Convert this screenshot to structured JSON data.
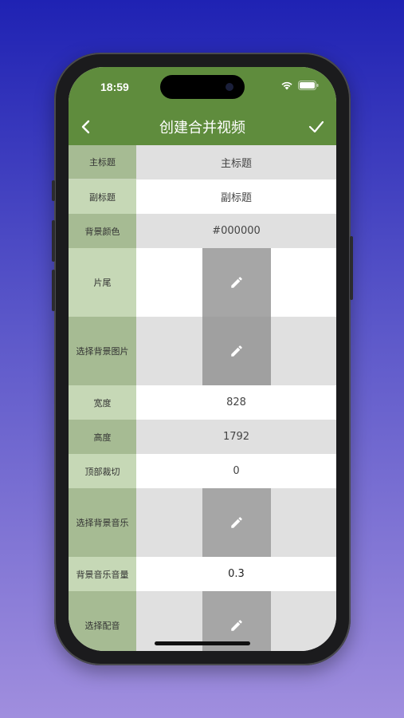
{
  "status": {
    "time": "18:59"
  },
  "nav": {
    "title": "创建合并视频"
  },
  "rows": [
    {
      "label": "主标题",
      "value": "主标题"
    },
    {
      "label": "副标题",
      "value": "副标题"
    },
    {
      "label": "背景颜色",
      "value": "#000000"
    },
    {
      "label": "片尾"
    },
    {
      "label": "选择背景图片"
    },
    {
      "label": "宽度",
      "value": "828"
    },
    {
      "label": "高度",
      "value": "1792"
    },
    {
      "label": "顶部裁切",
      "value": "0"
    },
    {
      "label": "选择背景音乐"
    },
    {
      "label": "背景音乐音量",
      "value": "0.3"
    },
    {
      "label": "选择配音"
    }
  ],
  "colors": {
    "accent": "#5f8c3d",
    "label_dark": "#a6bb93",
    "label_light": "#c6d8b6",
    "edit_box": "#a6a6a6"
  },
  "icons": [
    "back-chevron-icon",
    "checkmark-icon",
    "wifi-icon",
    "battery-icon",
    "pencil-icon"
  ]
}
